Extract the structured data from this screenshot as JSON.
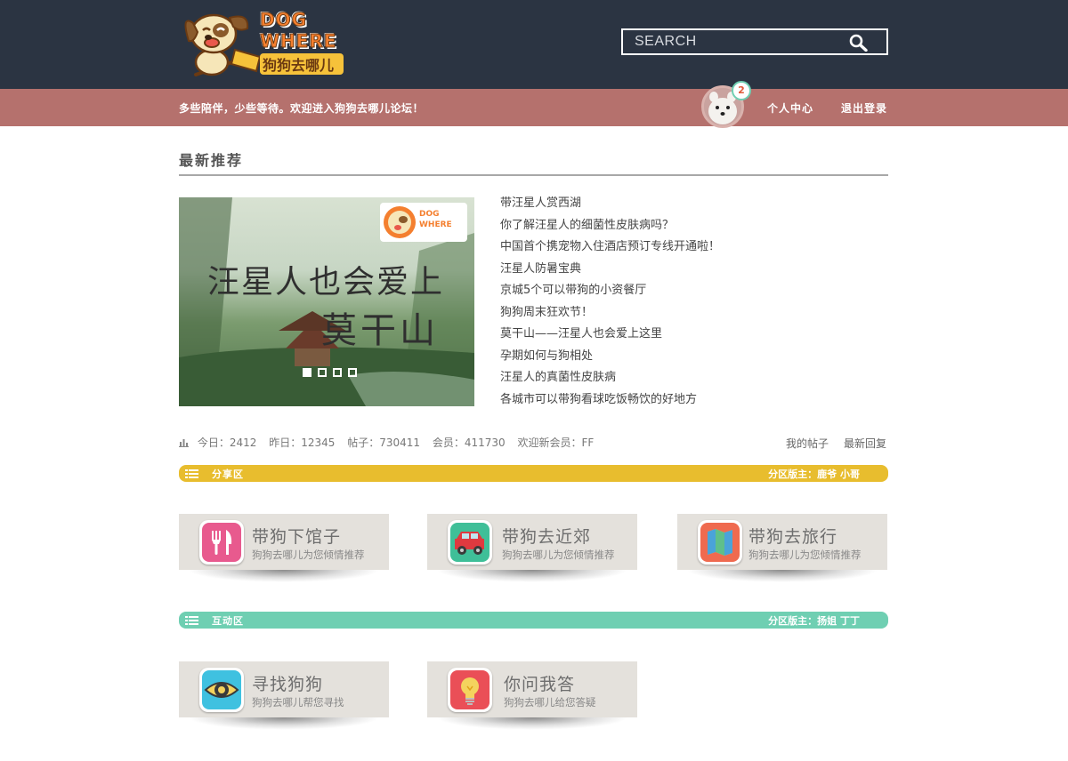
{
  "header": {
    "logo_text_line1": "DOG",
    "logo_text_line2": "WHERE",
    "logo_text_cn": "狗狗去哪儿",
    "search_placeholder": "SEARCH"
  },
  "subbar": {
    "welcome": "多些陪伴，少些等待。欢迎进入狗狗去哪儿论坛！",
    "notification_count": "2",
    "links": {
      "profile": "个人中心",
      "logout": "退出登录"
    }
  },
  "latest": {
    "title": "最新推荐",
    "banner": {
      "line1": "汪星人也会爱上",
      "line2": "莫干山",
      "logo_line1": "DOG",
      "logo_line2": "WHERE",
      "slides": 4,
      "active_slide": 1
    },
    "news": [
      "带汪星人赏西湖",
      "你了解汪星人的细菌性皮肤病吗？",
      "中国首个携宠物入住酒店预订专线开通啦！",
      "汪星人防暑宝典",
      "京城5个可以带狗的小资餐厅",
      "狗狗周末狂欢节！",
      "莫干山——汪星人也会爱上这里",
      "孕期如何与狗相处",
      "汪星人的真菌性皮肤病",
      "各城市可以带狗看球吃饭畅饮的好地方"
    ]
  },
  "stats": {
    "today": "今日：2412",
    "yesterday": "昨日：12345",
    "posts": "帖子：730411",
    "members": "会员：411730",
    "newest": "欢迎新会员：FF",
    "my_posts": "我的帖子",
    "latest_reply": "最新回复"
  },
  "sections": [
    {
      "name": "分享区",
      "moderators": "分区版主：鹿爷 小哥",
      "color": "#e8bd2e",
      "cards": [
        {
          "title": "带狗下馆子",
          "subtitle": "狗狗去哪儿为您倾情推荐",
          "icon": "fork-knife-icon",
          "color": "#e85a8e"
        },
        {
          "title": "带狗去近郊",
          "subtitle": "狗狗去哪儿为您倾情推荐",
          "icon": "car-icon",
          "color": "#3fbf98"
        },
        {
          "title": "带狗去旅行",
          "subtitle": "狗狗去哪儿为您倾情推荐",
          "icon": "map-icon",
          "color": "#ef6a4f"
        }
      ]
    },
    {
      "name": "互动区",
      "moderators": "分区版主：扬姐 丁丁",
      "color": "#6fcfb2",
      "cards": [
        {
          "title": "寻找狗狗",
          "subtitle": "狗狗去哪儿帮您寻找",
          "icon": "eye-icon",
          "color": "#3fc1e0"
        },
        {
          "title": "你问我答",
          "subtitle": "狗狗去哪儿给您答疑",
          "icon": "lightbulb-icon",
          "color": "#ea4f57"
        }
      ]
    }
  ]
}
